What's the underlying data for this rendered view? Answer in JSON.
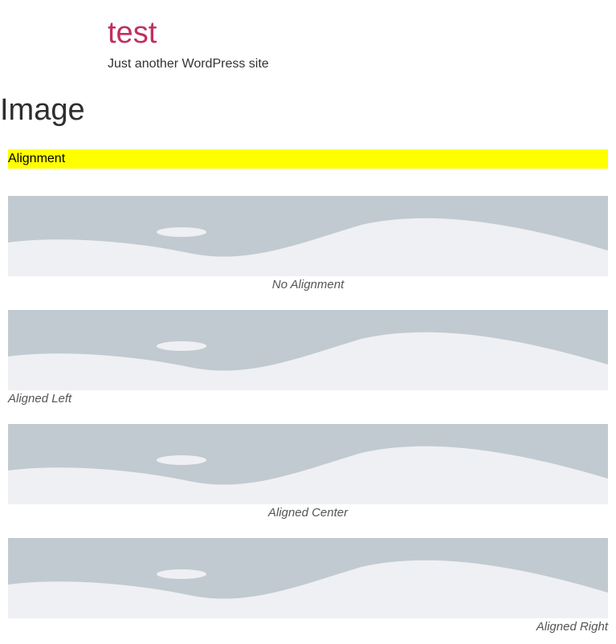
{
  "site": {
    "title": "test",
    "tagline": "Just another WordPress site"
  },
  "page": {
    "title": "Image"
  },
  "section": {
    "heading": "Alignment"
  },
  "figures": [
    {
      "caption": "No Alignment",
      "align": "none"
    },
    {
      "caption": "Aligned Left",
      "align": "left"
    },
    {
      "caption": "Aligned Center",
      "align": "center"
    },
    {
      "caption": "Aligned Right",
      "align": "right"
    }
  ],
  "colors": {
    "site_title": "#c0305f",
    "highlight": "#ffff00",
    "placeholder_sky": "#c2cad1",
    "placeholder_ground": "#eff0f3"
  }
}
